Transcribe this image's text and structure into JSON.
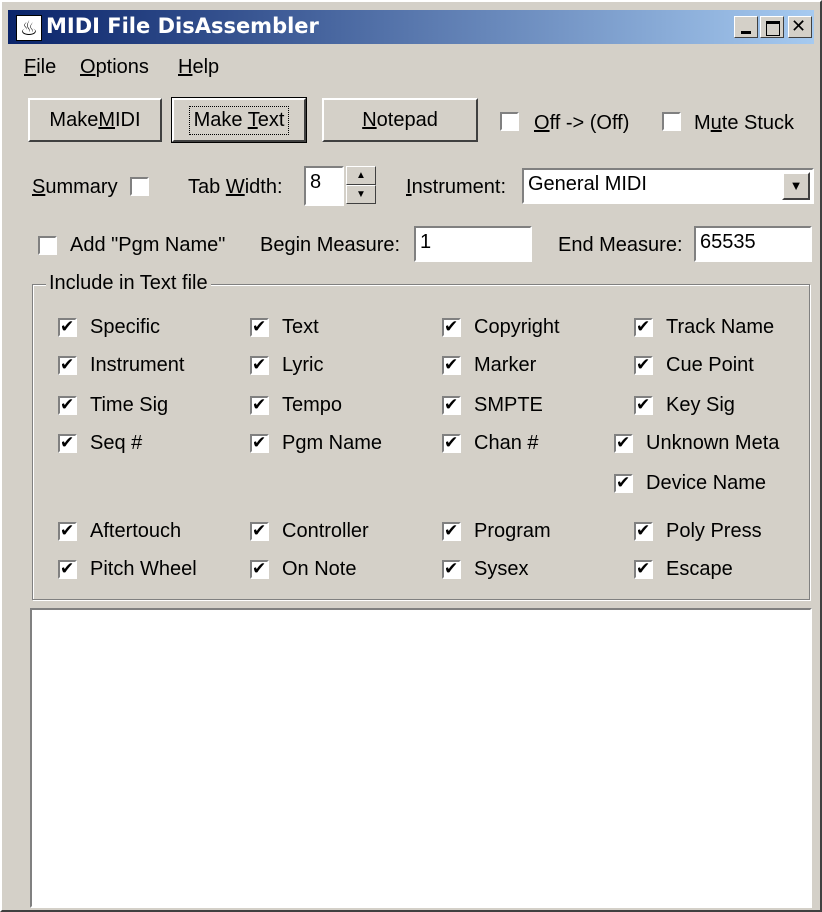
{
  "window": {
    "title": "MIDI File DisAssembler",
    "app_icon": "music-clef-icon",
    "caption_buttons": [
      "minimize-icon",
      "maximize-icon",
      "close-icon"
    ]
  },
  "menu": {
    "file": {
      "mnemonic": "F",
      "rest": "ile"
    },
    "options": {
      "mnemonic": "O",
      "rest": "ptions"
    },
    "help": {
      "mnemonic": "H",
      "rest": "elp"
    }
  },
  "toolbar": {
    "make_midi": {
      "pre": "Make ",
      "mnemonic": "M",
      "post": "IDI"
    },
    "make_text": {
      "pre": "Make ",
      "mnemonic": "T",
      "post": "ext"
    },
    "notepad": {
      "pre": "",
      "mnemonic": "N",
      "post": "otepad"
    },
    "off_option": {
      "mnemonic": "O",
      "post": "ff -> (Off)",
      "checked": false
    },
    "mute_stuck": {
      "pre": "M",
      "mnemonic": "u",
      "post": "te Stuck",
      "checked": false
    }
  },
  "settings": {
    "summary": {
      "mnemonic": "S",
      "post": "ummary",
      "checked": false
    },
    "tab_width": {
      "pre": "Tab ",
      "mnemonic": "W",
      "post": "idth:",
      "value": "8"
    },
    "instrument": {
      "mnemonic": "I",
      "post": "nstrument:",
      "value": "General MIDI"
    },
    "add_pgm_name": {
      "label": "Add \"Pgm Name\"",
      "checked": false
    },
    "begin_measure": {
      "label": "Begin Measure:",
      "value": "1"
    },
    "end_measure": {
      "label": "End Measure:",
      "value": "65535"
    }
  },
  "include": {
    "title": "Include in Text file",
    "items": [
      {
        "label": "Specific",
        "checked": true
      },
      {
        "label": "Text",
        "checked": true
      },
      {
        "label": "Copyright",
        "checked": true
      },
      {
        "label": "Track Name",
        "checked": true
      },
      {
        "label": "Instrument",
        "checked": true
      },
      {
        "label": "Lyric",
        "checked": true
      },
      {
        "label": "Marker",
        "checked": true
      },
      {
        "label": "Cue Point",
        "checked": true
      },
      {
        "label": "Time Sig",
        "checked": true
      },
      {
        "label": "Tempo",
        "checked": true
      },
      {
        "label": "SMPTE",
        "checked": true
      },
      {
        "label": "Key Sig",
        "checked": true
      },
      {
        "label": "Seq #",
        "checked": true
      },
      {
        "label": "Pgm Name",
        "checked": true
      },
      {
        "label": "Chan #",
        "checked": true
      },
      {
        "label": "Unknown Meta",
        "checked": true
      },
      {
        "label": "Device Name",
        "checked": true
      },
      {
        "label": "Aftertouch",
        "checked": true
      },
      {
        "label": "Controller",
        "checked": true
      },
      {
        "label": "Program",
        "checked": true
      },
      {
        "label": "Poly Press",
        "checked": true
      },
      {
        "label": "Pitch Wheel",
        "checked": true
      },
      {
        "label": "On Note",
        "checked": true
      },
      {
        "label": "Sysex",
        "checked": true
      },
      {
        "label": "Escape",
        "checked": true
      }
    ]
  },
  "output": {
    "text": ""
  },
  "colors": {
    "titlebar_start": "#0a246a",
    "titlebar_end": "#a6caf0",
    "face": "#d4d0c8"
  }
}
